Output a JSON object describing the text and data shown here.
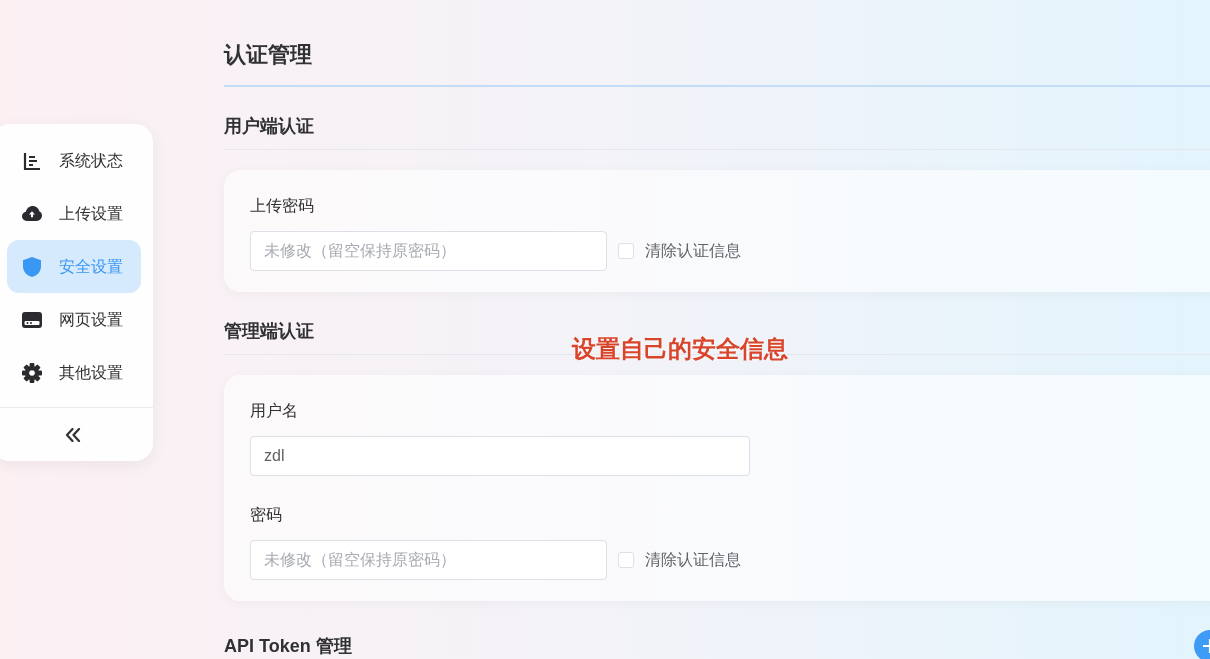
{
  "sidebar": {
    "items": [
      {
        "label": "系统状态",
        "selected": false
      },
      {
        "label": "上传设置",
        "selected": false
      },
      {
        "label": "安全设置",
        "selected": true
      },
      {
        "label": "网页设置",
        "selected": false
      },
      {
        "label": "其他设置",
        "selected": false
      }
    ]
  },
  "page": {
    "title": "认证管理"
  },
  "sections": [
    {
      "title": "用户端认证",
      "add_button": false,
      "fields": [
        {
          "label": "上传密码",
          "kind": "password",
          "placeholder": "未修改（留空保持原密码）",
          "clear_option": {
            "label": "清除认证信息",
            "checked": false
          }
        }
      ]
    },
    {
      "title": "管理端认证",
      "add_button": false,
      "fields": [
        {
          "label": "用户名",
          "kind": "text",
          "value": "zdl"
        },
        {
          "label": "密码",
          "kind": "password",
          "placeholder": "未修改（留空保持原密码）",
          "clear_option": {
            "label": "清除认证信息",
            "checked": false
          }
        }
      ]
    },
    {
      "title": "API Token 管理",
      "add_button": true
    }
  ],
  "annotation": "设置自己的安全信息"
}
